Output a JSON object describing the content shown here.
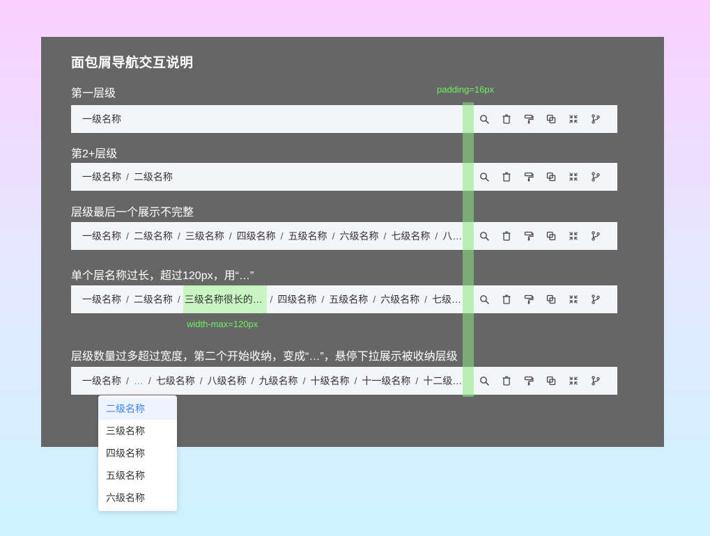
{
  "title": "面包屑导航交互说明",
  "annotations": {
    "padding": "padding=16px",
    "width_max": "width-max=120px"
  },
  "sections": [
    {
      "label": "第一层级",
      "crumbs": [
        "一级名称"
      ]
    },
    {
      "label": "第2+层级",
      "crumbs": [
        "一级名称",
        "二级名称"
      ]
    },
    {
      "label": "层级最后一个展示不完整",
      "crumbs": [
        "一级名称",
        "二级名称",
        "三级名称",
        "四级名称",
        "五级名称",
        "六级名称",
        "七级名称",
        "八…"
      ]
    },
    {
      "label": "单个层名称过长，超过120px，用“…”",
      "crumbs": [
        "一级名称",
        "二级名称",
        "三级名称很长的时…",
        "四级名称",
        "五级名称",
        "六级名称",
        "七级…"
      ]
    },
    {
      "label": "层级数量过多超过宽度，第二个开始收纳，变成“…”，悬停下拉展示被收纳层级",
      "crumbs": [
        "一级名称",
        "…",
        "七级名称",
        "八级名称",
        "九级名称",
        "十级名称",
        "十一级名称",
        "十二级…"
      ]
    }
  ],
  "separator": "/",
  "toolbar_icons": [
    "search-icon",
    "trash-icon",
    "paint-roller-icon",
    "copy-icon",
    "fullscreen-icon",
    "branch-icon"
  ],
  "dropdown": {
    "items": [
      "二级名称",
      "三级名称",
      "四级名称",
      "五级名称",
      "六级名称"
    ],
    "active_index": 0
  },
  "colors": {
    "panel": "#666666",
    "bar": "#f4f5f9",
    "highlight": "#c9f5c2",
    "annotation": "#6ef261",
    "link": "#3b82f6"
  }
}
